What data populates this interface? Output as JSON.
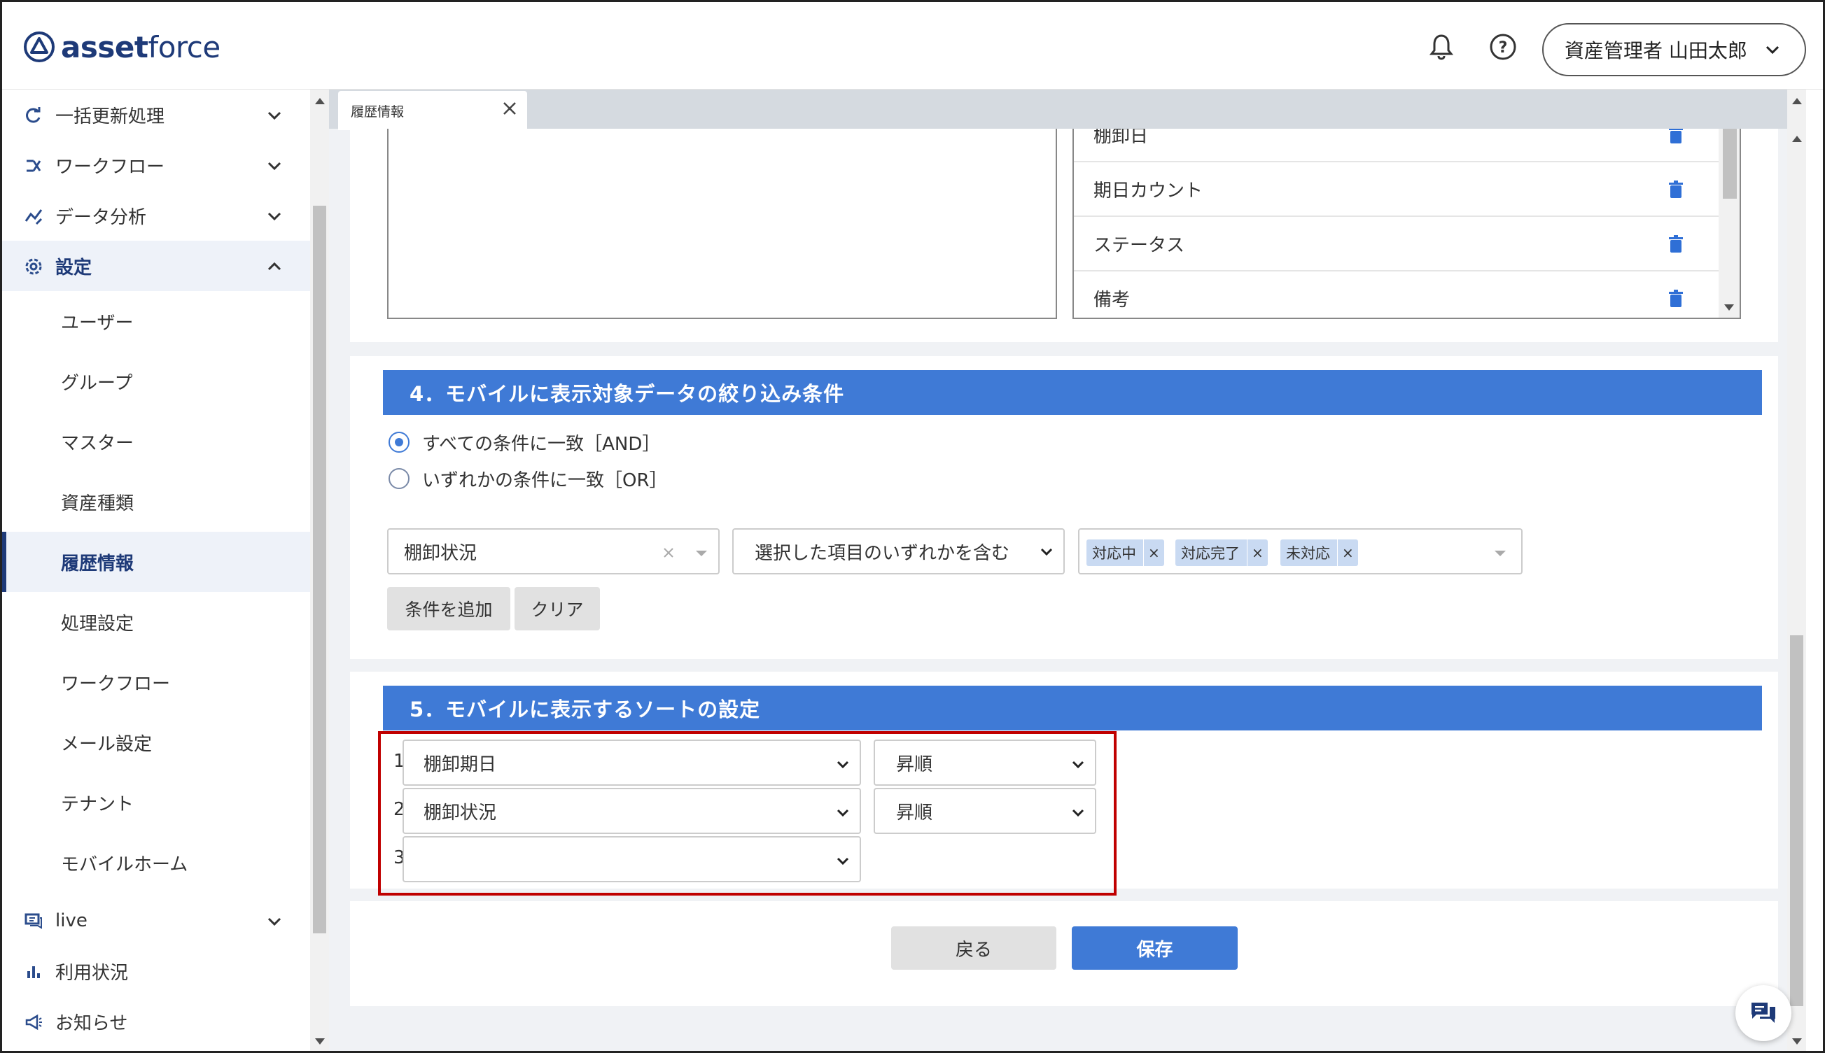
{
  "app": {
    "logo_bold": "asset",
    "logo_light": "force",
    "user_label": "資産管理者 山田太郎"
  },
  "sidebar": {
    "items": [
      {
        "label": "一括更新処理",
        "icon": "refresh-icon"
      },
      {
        "label": "ワークフロー",
        "icon": "workflow-icon"
      },
      {
        "label": "データ分析",
        "icon": "analytics-icon"
      },
      {
        "label": "設定",
        "icon": "gear-icon"
      },
      {
        "label": "live",
        "icon": "chat-icon"
      },
      {
        "label": "利用状況",
        "icon": "bar-chart-icon"
      },
      {
        "label": "お知らせ",
        "icon": "megaphone-icon"
      }
    ],
    "sub_items": [
      {
        "label": "ユーザー"
      },
      {
        "label": "グループ"
      },
      {
        "label": "マスター"
      },
      {
        "label": "資産種類"
      },
      {
        "label": "履歴情報"
      },
      {
        "label": "処理設定"
      },
      {
        "label": "ワークフロー"
      },
      {
        "label": "メール設定"
      },
      {
        "label": "テナント"
      },
      {
        "label": "モバイルホーム"
      }
    ]
  },
  "tab": {
    "label": "履歴情報"
  },
  "field_list": {
    "rows": [
      "棚卸日",
      "期日カウント",
      "ステータス",
      "備考"
    ]
  },
  "section4": {
    "title": "4．モバイルに表示対象データの絞り込み条件",
    "radio_and": "すべての条件に一致［AND］",
    "radio_or": "いずれかの条件に一致［OR］",
    "field_select": "棚卸状況",
    "operator_select": "選択した項目のいずれかを含む",
    "chips": [
      "対応中",
      "対応完了",
      "未対応"
    ],
    "add_button": "条件を追加",
    "clear_button": "クリア"
  },
  "section5": {
    "title": "5．モバイルに表示するソートの設定",
    "rows": [
      {
        "num": "1",
        "field": "棚卸期日",
        "order": "昇順"
      },
      {
        "num": "2",
        "field": "棚卸状況",
        "order": "昇順"
      },
      {
        "num": "3",
        "field": "",
        "order": ""
      }
    ]
  },
  "footer": {
    "back_label": "戻る",
    "save_label": "保存"
  },
  "colors": {
    "accent": "#3f7ad6",
    "brand": "#1e3a78",
    "highlight_border": "#c00000"
  }
}
